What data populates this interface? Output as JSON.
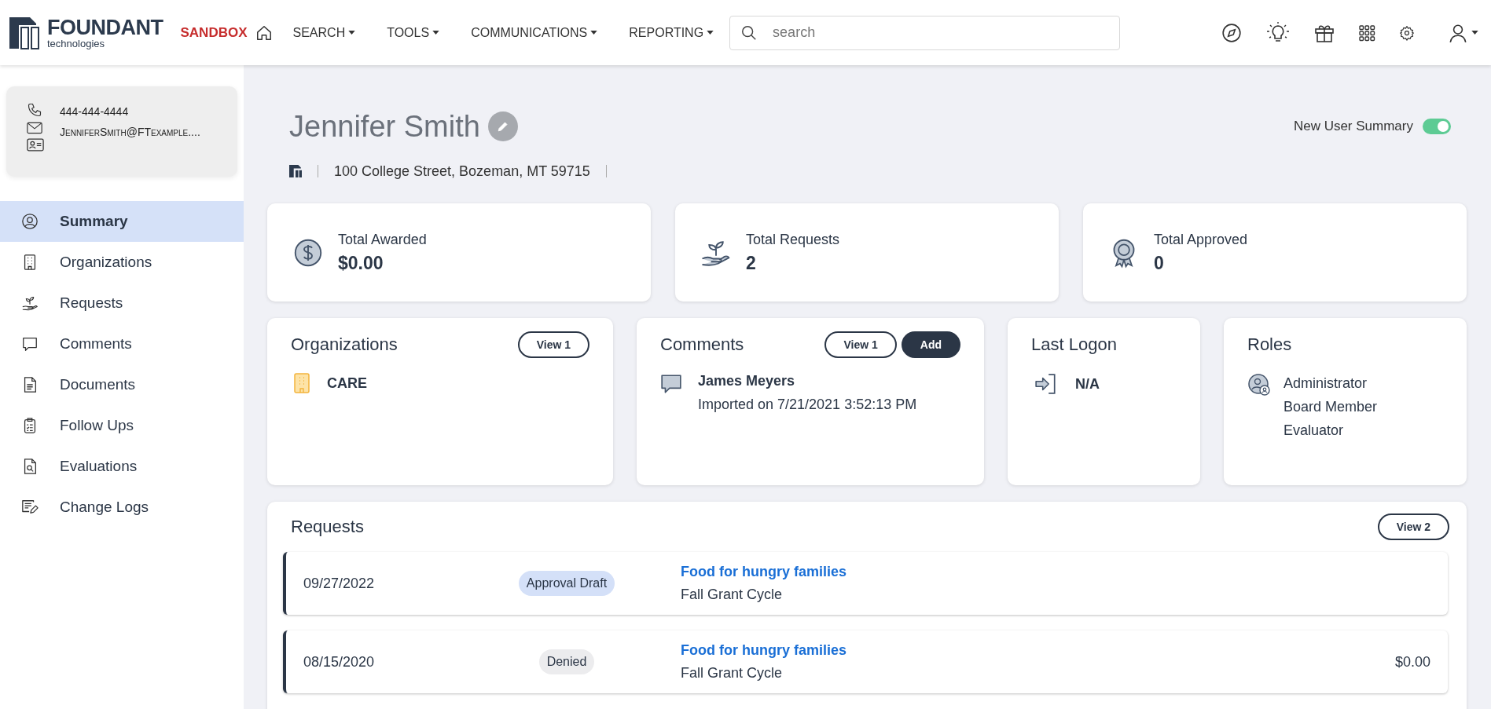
{
  "header": {
    "logo": {
      "name": "FOUNDANT",
      "tagline": "technologies"
    },
    "environment": "SANDBOX",
    "nav": [
      {
        "label": "SEARCH"
      },
      {
        "label": "TOOLS"
      },
      {
        "label": "COMMUNICATIONS"
      },
      {
        "label": "REPORTING"
      }
    ],
    "search": {
      "placeholder": "search"
    }
  },
  "contact": {
    "phone": "444-444-4444",
    "email": "JenniferSmith@FTexample...."
  },
  "sidebar": {
    "items": [
      {
        "label": "Summary",
        "selected": true
      },
      {
        "label": "Organizations",
        "selected": false
      },
      {
        "label": "Requests",
        "selected": false
      },
      {
        "label": "Comments",
        "selected": false
      },
      {
        "label": "Documents",
        "selected": false
      },
      {
        "label": "Follow Ups",
        "selected": false
      },
      {
        "label": "Evaluations",
        "selected": false
      },
      {
        "label": "Change Logs",
        "selected": false
      }
    ]
  },
  "profile": {
    "name": "Jennifer Smith",
    "address": "100 College Street, Bozeman, MT 59715",
    "new_user_summary": {
      "label": "New User Summary",
      "on": true
    }
  },
  "stats": [
    {
      "label": "Total Awarded",
      "value": "$0.00"
    },
    {
      "label": "Total Requests",
      "value": "2"
    },
    {
      "label": "Total Approved",
      "value": "0"
    }
  ],
  "organizations": {
    "title": "Organizations",
    "button": "View 1",
    "items": [
      "CARE"
    ]
  },
  "comments": {
    "title": "Comments",
    "buttons": [
      "View 1",
      "Add"
    ],
    "items": [
      {
        "author": "James Meyers",
        "detail": "Imported on 7/21/2021 3:52:13 PM"
      }
    ]
  },
  "last_logon": {
    "title": "Last Logon",
    "value": "N/A"
  },
  "roles": {
    "title": "Roles",
    "items": [
      "Administrator",
      "Board Member",
      "Evaluator"
    ]
  },
  "requests": {
    "title": "Requests",
    "button": "View 2",
    "rows": [
      {
        "date": "09/27/2022",
        "status": "Approval Draft",
        "color": "#d4e0f8",
        "title": "Food for hungry families",
        "cycle": "Fall Grant Cycle"
      },
      {
        "date": "08/15/2020",
        "status": "Denied",
        "color": "#ececee",
        "title": "Food for hungry families",
        "cycle": "Fall Grant Cycle",
        "amount": "$0.00"
      }
    ]
  }
}
